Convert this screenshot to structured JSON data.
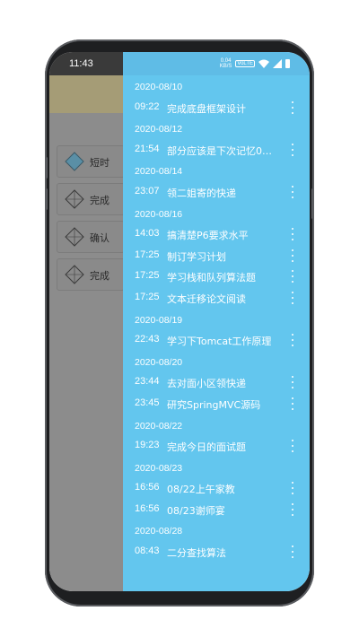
{
  "status_bar": {
    "time": "11:43",
    "net_speed_value": "0.04",
    "net_speed_unit": "KB/S",
    "volte_label": "VoLTE"
  },
  "background": {
    "cards": [
      {
        "label": "短时"
      },
      {
        "label": "完成"
      },
      {
        "label": "确认"
      },
      {
        "label": "完成"
      }
    ]
  },
  "drawer": {
    "groups": [
      {
        "date": "2020-08/10",
        "items": [
          {
            "time": "09:22",
            "title": "完成底盘框架设计"
          }
        ]
      },
      {
        "date": "2020-08/12",
        "items": [
          {
            "time": "21:54",
            "title": "部分应该是下次记忆0…"
          }
        ]
      },
      {
        "date": "2020-08/14",
        "items": [
          {
            "time": "23:07",
            "title": "领二姐寄的快递"
          }
        ]
      },
      {
        "date": "2020-08/16",
        "items": [
          {
            "time": "14:03",
            "title": "搞清楚P6要求水平"
          },
          {
            "time": "17:25",
            "title": "制订学习计划"
          },
          {
            "time": "17:25",
            "title": "学习栈和队列算法题"
          },
          {
            "time": "17:25",
            "title": "文本迁移论文阅读"
          }
        ]
      },
      {
        "date": "2020-08/19",
        "items": [
          {
            "time": "22:43",
            "title": "学习下Tomcat工作原理"
          }
        ]
      },
      {
        "date": "2020-08/20",
        "items": [
          {
            "time": "23:44",
            "title": "去对面小区领快递"
          },
          {
            "time": "23:45",
            "title": "研究SpringMVC源码"
          }
        ]
      },
      {
        "date": "2020-08/22",
        "items": [
          {
            "time": "19:23",
            "title": "完成今日的面试题"
          }
        ]
      },
      {
        "date": "2020-08/23",
        "items": [
          {
            "time": "16:56",
            "title": "08/22上午家教"
          },
          {
            "time": "16:56",
            "title": "08/23谢师宴"
          }
        ]
      },
      {
        "date": "2020-08/28",
        "items": [
          {
            "time": "08:43",
            "title": "二分查找算法"
          }
        ]
      }
    ]
  },
  "colors": {
    "drawer_bg": "#63c6ee",
    "scrim": "#8c8c8c",
    "phone_frame": "#1e1f21"
  }
}
